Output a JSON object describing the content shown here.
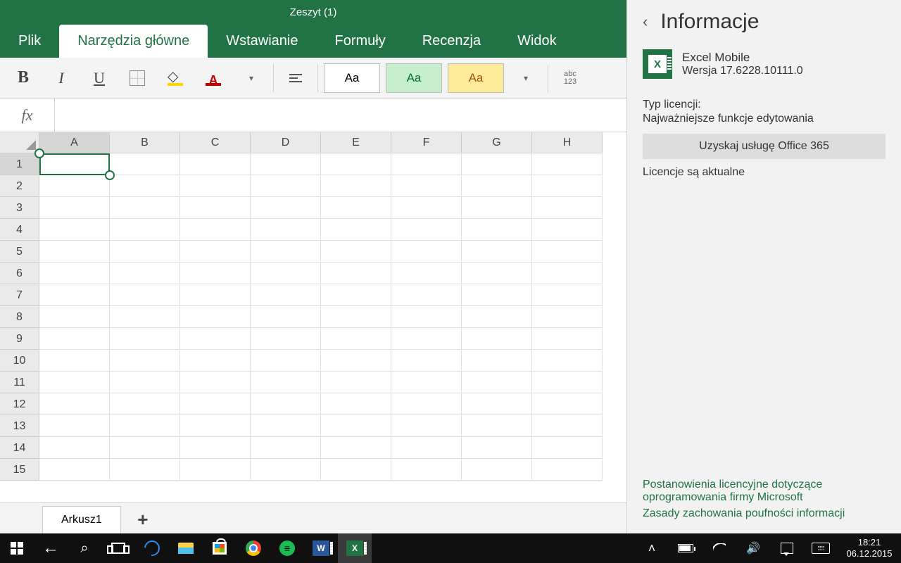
{
  "title": "Zeszyt (1)",
  "tabs": {
    "file": "Plik",
    "home": "Narzędzia główne",
    "insert": "Wstawianie",
    "formulas": "Formuły",
    "review": "Recenzja",
    "view": "Widok"
  },
  "style_boxes": {
    "normal": "Aa",
    "good": "Aa",
    "neutral": "Aa"
  },
  "wrap_text": "abc\n123",
  "formula_fx": "fx",
  "columns": [
    "A",
    "B",
    "C",
    "D",
    "E",
    "F",
    "G",
    "H"
  ],
  "rows": [
    "1",
    "2",
    "3",
    "4",
    "5",
    "6",
    "7",
    "8",
    "9",
    "10",
    "11",
    "12",
    "13",
    "14",
    "15"
  ],
  "sheet": {
    "name": "Arkusz1",
    "add": "+"
  },
  "info": {
    "title": "Informacje",
    "app_name": "Excel Mobile",
    "version": "Wersja 17.6228.10111.0",
    "license_label": "Typ licencji:",
    "license_value": "Najważniejsze funkcje edytowania",
    "get_office": "Uzyskaj usługę Office 365",
    "license_status": "Licencje są aktualne",
    "link_terms": "Postanowienia licencyjne dotyczące oprogramowania firmy Microsoft",
    "link_privacy": "Zasady zachowania poufności informacji"
  },
  "taskbar": {
    "time": "18:21",
    "date": "06.12.2015"
  }
}
